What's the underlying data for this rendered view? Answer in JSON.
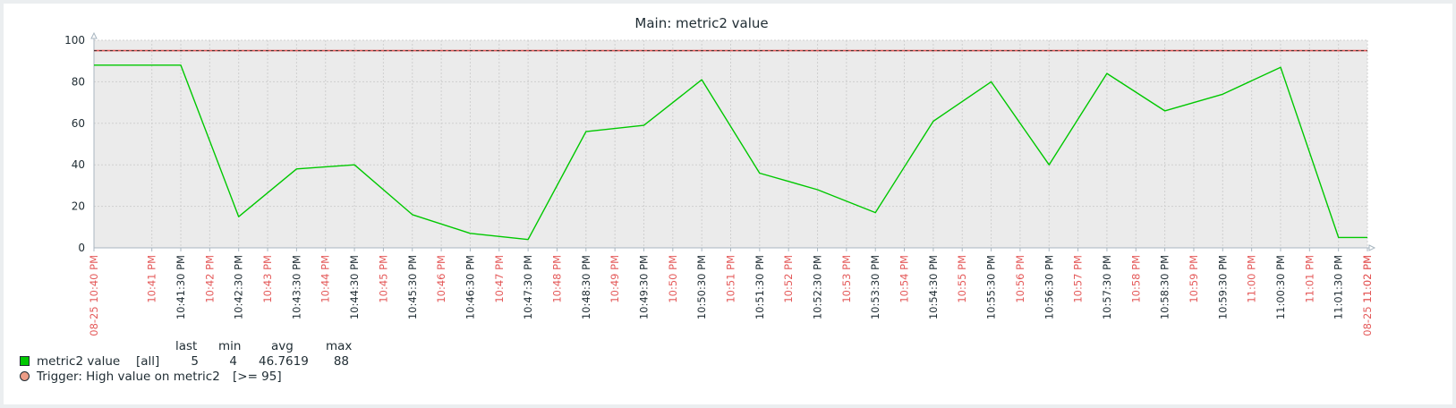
{
  "chart_data": {
    "type": "line",
    "title": "Main: metric2 value",
    "ylim": [
      0,
      100
    ],
    "yticks": [
      0,
      20,
      40,
      60,
      80,
      100
    ],
    "x_range": [
      "22:40:00",
      "23:02:00"
    ],
    "x_tick_labels": [
      {
        "t": "22:40:00",
        "label": "08-25 10:40 PM",
        "red": true
      },
      {
        "t": "22:41:00",
        "label": "10:41 PM",
        "red": true
      },
      {
        "t": "22:41:30",
        "label": "10:41:30 PM",
        "red": false
      },
      {
        "t": "22:42:00",
        "label": "10:42 PM",
        "red": true
      },
      {
        "t": "22:42:30",
        "label": "10:42:30 PM",
        "red": false
      },
      {
        "t": "22:43:00",
        "label": "10:43 PM",
        "red": true
      },
      {
        "t": "22:43:30",
        "label": "10:43:30 PM",
        "red": false
      },
      {
        "t": "22:44:00",
        "label": "10:44 PM",
        "red": true
      },
      {
        "t": "22:44:30",
        "label": "10:44:30 PM",
        "red": false
      },
      {
        "t": "22:45:00",
        "label": "10:45 PM",
        "red": true
      },
      {
        "t": "22:45:30",
        "label": "10:45:30 PM",
        "red": false
      },
      {
        "t": "22:46:00",
        "label": "10:46 PM",
        "red": true
      },
      {
        "t": "22:46:30",
        "label": "10:46:30 PM",
        "red": false
      },
      {
        "t": "22:47:00",
        "label": "10:47 PM",
        "red": true
      },
      {
        "t": "22:47:30",
        "label": "10:47:30 PM",
        "red": false
      },
      {
        "t": "22:48:00",
        "label": "10:48 PM",
        "red": true
      },
      {
        "t": "22:48:30",
        "label": "10:48:30 PM",
        "red": false
      },
      {
        "t": "22:49:00",
        "label": "10:49 PM",
        "red": true
      },
      {
        "t": "22:49:30",
        "label": "10:49:30 PM",
        "red": false
      },
      {
        "t": "22:50:00",
        "label": "10:50 PM",
        "red": true
      },
      {
        "t": "22:50:30",
        "label": "10:50:30 PM",
        "red": false
      },
      {
        "t": "22:51:00",
        "label": "10:51 PM",
        "red": true
      },
      {
        "t": "22:51:30",
        "label": "10:51:30 PM",
        "red": false
      },
      {
        "t": "22:52:00",
        "label": "10:52 PM",
        "red": true
      },
      {
        "t": "22:52:30",
        "label": "10:52:30 PM",
        "red": false
      },
      {
        "t": "22:53:00",
        "label": "10:53 PM",
        "red": true
      },
      {
        "t": "22:53:30",
        "label": "10:53:30 PM",
        "red": false
      },
      {
        "t": "22:54:00",
        "label": "10:54 PM",
        "red": true
      },
      {
        "t": "22:54:30",
        "label": "10:54:30 PM",
        "red": false
      },
      {
        "t": "22:55:00",
        "label": "10:55 PM",
        "red": true
      },
      {
        "t": "22:55:30",
        "label": "10:55:30 PM",
        "red": false
      },
      {
        "t": "22:56:00",
        "label": "10:56 PM",
        "red": true
      },
      {
        "t": "22:56:30",
        "label": "10:56:30 PM",
        "red": false
      },
      {
        "t": "22:57:00",
        "label": "10:57 PM",
        "red": true
      },
      {
        "t": "22:57:30",
        "label": "10:57:30 PM",
        "red": false
      },
      {
        "t": "22:58:00",
        "label": "10:58 PM",
        "red": true
      },
      {
        "t": "22:58:30",
        "label": "10:58:30 PM",
        "red": false
      },
      {
        "t": "22:59:00",
        "label": "10:59 PM",
        "red": true
      },
      {
        "t": "22:59:30",
        "label": "10:59:30 PM",
        "red": false
      },
      {
        "t": "23:00:00",
        "label": "11:00 PM",
        "red": true
      },
      {
        "t": "23:00:30",
        "label": "11:00:30 PM",
        "red": false
      },
      {
        "t": "23:01:00",
        "label": "11:01 PM",
        "red": true
      },
      {
        "t": "23:01:30",
        "label": "11:01:30 PM",
        "red": false
      },
      {
        "t": "23:02:00",
        "label": "11:02 PM",
        "red": true
      },
      {
        "t": "23:02:00",
        "label": "08-25 11:02 PM",
        "red": true
      }
    ],
    "series": [
      {
        "name": "metric2 value",
        "color": "#00c800",
        "points": [
          {
            "t": "22:40:00",
            "v": 88
          },
          {
            "t": "22:41:30",
            "v": 88
          },
          {
            "t": "22:42:30",
            "v": 15
          },
          {
            "t": "22:43:30",
            "v": 38
          },
          {
            "t": "22:44:30",
            "v": 40
          },
          {
            "t": "22:45:30",
            "v": 16
          },
          {
            "t": "22:46:30",
            "v": 7
          },
          {
            "t": "22:47:30",
            "v": 4
          },
          {
            "t": "22:48:30",
            "v": 56
          },
          {
            "t": "22:49:30",
            "v": 59
          },
          {
            "t": "22:50:30",
            "v": 81
          },
          {
            "t": "22:51:30",
            "v": 36
          },
          {
            "t": "22:52:30",
            "v": 28
          },
          {
            "t": "22:53:30",
            "v": 17
          },
          {
            "t": "22:54:30",
            "v": 61
          },
          {
            "t": "22:55:30",
            "v": 80
          },
          {
            "t": "22:56:30",
            "v": 40
          },
          {
            "t": "22:57:30",
            "v": 84
          },
          {
            "t": "22:58:30",
            "v": 66
          },
          {
            "t": "22:59:30",
            "v": 74
          },
          {
            "t": "23:00:30",
            "v": 87
          },
          {
            "t": "23:01:30",
            "v": 5
          },
          {
            "t": "23:02:00",
            "v": 5
          }
        ]
      }
    ],
    "trigger": {
      "value": 95,
      "color": "#e45959"
    },
    "grid": true,
    "legend_position": "bottom-left",
    "colors": {
      "plot_bg": "#ebebeb",
      "axis": "#a8b6c0",
      "grid": "#cfcfcf",
      "red_label": "#e45959",
      "dark_label": "#1f2c33"
    }
  },
  "legend": {
    "headers": {
      "last": "last",
      "min": "min",
      "avg": "avg",
      "max": "max"
    },
    "items": [
      {
        "swatch": "green-square",
        "label": "metric2 value",
        "func": "[all]",
        "last": "5",
        "min": "4",
        "avg": "46.7619",
        "max": "88",
        "color": "#00c800"
      },
      {
        "swatch": "salmon-circle",
        "label": "Trigger: High value on metric2",
        "cond": "[>= 95]",
        "color": "#ec9d87"
      }
    ]
  }
}
